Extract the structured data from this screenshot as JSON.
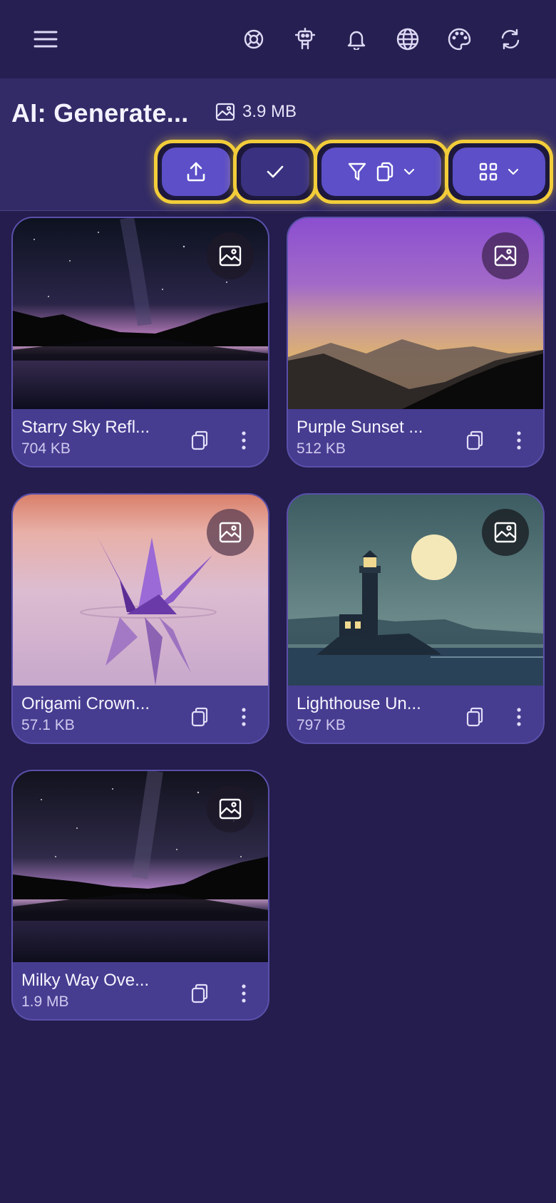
{
  "topbar": {
    "icons": [
      "menu-icon",
      "lifebuoy-icon",
      "robot-icon",
      "bell-icon",
      "globe-icon",
      "palette-icon",
      "refresh-icon"
    ]
  },
  "header": {
    "title": "AI: Generate...",
    "total_size": "3.9 MB"
  },
  "toolbar": {
    "buttons": [
      {
        "name": "upload",
        "icon": "upload-icon"
      },
      {
        "name": "select",
        "icon": "check-icon"
      },
      {
        "name": "filter",
        "icon": "filter-icon",
        "secondary_icon": "copy-icon"
      },
      {
        "name": "view",
        "icon": "grid-icon"
      }
    ],
    "highlight_color": "#f2cd3a"
  },
  "gallery": {
    "items": [
      {
        "name": "Starry Sky Refl...",
        "size": "704 KB"
      },
      {
        "name": "Purple Sunset ...",
        "size": "512 KB"
      },
      {
        "name": "Origami Crown...",
        "size": "57.1 KB"
      },
      {
        "name": "Lighthouse Un...",
        "size": "797 KB"
      },
      {
        "name": "Milky Way Ove...",
        "size": "1.9 MB"
      }
    ]
  },
  "colors": {
    "background": "#241d4d",
    "card": "#463d91",
    "accent": "#5c4fc8"
  }
}
